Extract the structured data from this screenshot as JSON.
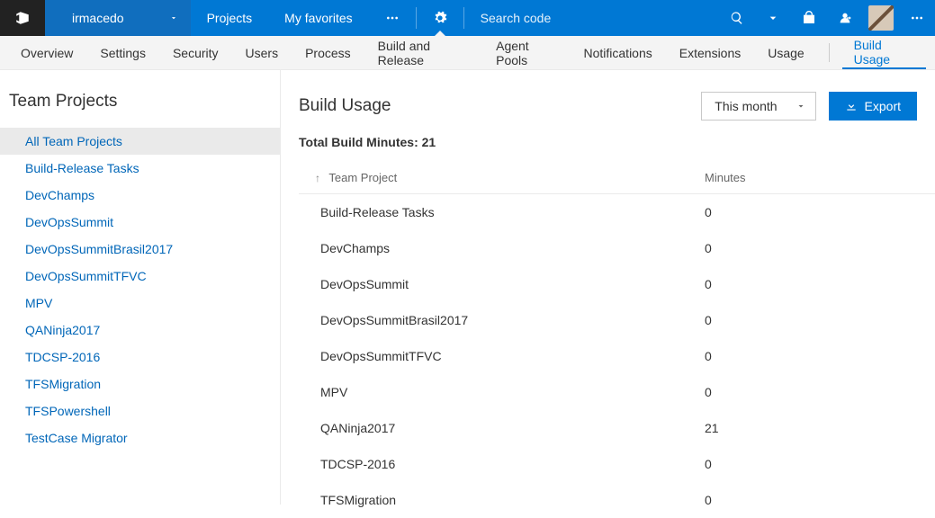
{
  "topbar": {
    "account": "irmacedo",
    "nav": [
      "Projects",
      "My favorites"
    ],
    "search_placeholder": "Search code"
  },
  "tabs": [
    "Overview",
    "Settings",
    "Security",
    "Users",
    "Process",
    "Build and Release",
    "Agent Pools",
    "Notifications",
    "Extensions",
    "Usage",
    "Build Usage"
  ],
  "active_tab": "Build Usage",
  "sidebar": {
    "title": "Team Projects",
    "items": [
      "All Team Projects",
      "Build-Release Tasks",
      "DevChamps",
      "DevOpsSummit",
      "DevOpsSummitBrasil2017",
      "DevOpsSummitTFVC",
      "MPV",
      "QANinja2017",
      "TDCSP-2016",
      "TFSMigration",
      "TFSPowershell",
      "TestCase Migrator"
    ],
    "active": "All Team Projects"
  },
  "content": {
    "title": "Build Usage",
    "period_selected": "This month",
    "export_label": "Export",
    "total_label": "Total Build Minutes:",
    "total_value": "21",
    "columns": [
      "Team Project",
      "Minutes"
    ],
    "rows": [
      {
        "project": "Build-Release Tasks",
        "minutes": "0"
      },
      {
        "project": "DevChamps",
        "minutes": "0"
      },
      {
        "project": "DevOpsSummit",
        "minutes": "0"
      },
      {
        "project": "DevOpsSummitBrasil2017",
        "minutes": "0"
      },
      {
        "project": "DevOpsSummitTFVC",
        "minutes": "0"
      },
      {
        "project": "MPV",
        "minutes": "0"
      },
      {
        "project": "QANinja2017",
        "minutes": "21"
      },
      {
        "project": "TDCSP-2016",
        "minutes": "0"
      },
      {
        "project": "TFSMigration",
        "minutes": "0"
      }
    ]
  }
}
